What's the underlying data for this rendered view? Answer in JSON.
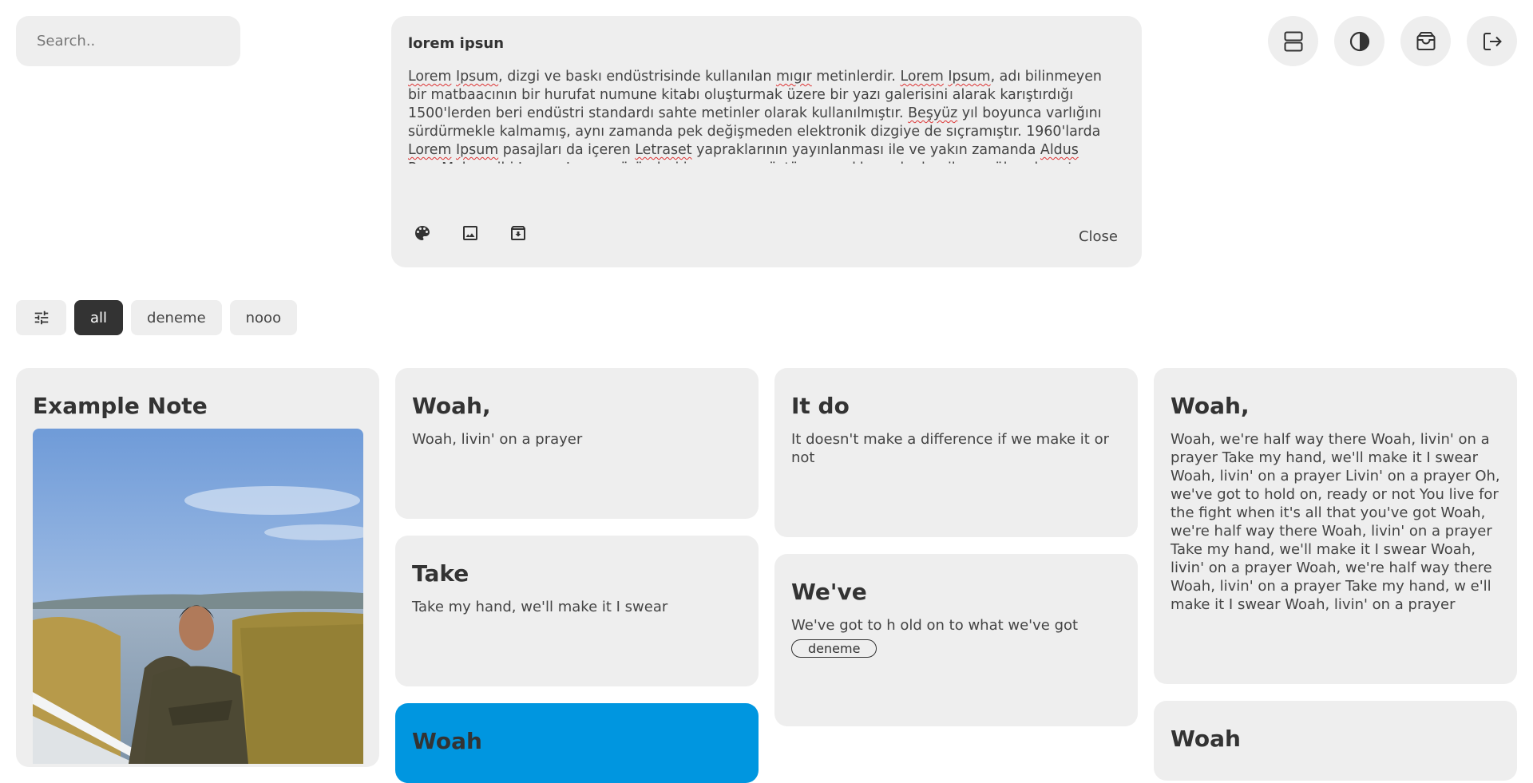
{
  "search": {
    "placeholder": "Search.."
  },
  "composer": {
    "title": "lorem ipsun",
    "body": [
      {
        "t": "Lorem",
        "sp": true
      },
      {
        "t": " "
      },
      {
        "t": "Ipsum",
        "sp": true
      },
      {
        "t": ", dizgi ve baskı endüstrisinde kullanılan "
      },
      {
        "t": "mıgır",
        "sp": true
      },
      {
        "t": " metinlerdir. "
      },
      {
        "t": "Lorem",
        "sp": true
      },
      {
        "t": " "
      },
      {
        "t": "Ipsum",
        "sp": true
      },
      {
        "t": ", adı bilinmeyen bir matbaacının bir hurufat numune kitabı oluşturmak üzere bir yazı galerisini alarak karıştırdığı 1500'lerden beri endüstri standardı sahte metinler olarak kullanılmıştır. "
      },
      {
        "t": "Beşyüz",
        "sp": true
      },
      {
        "t": " yıl boyunca varlığını sürdürmekle kalmamış, aynı zamanda pek değişmeden elektronik dizgiye de sıçramıştır. 1960'larda "
      },
      {
        "t": "Lorem",
        "sp": true
      },
      {
        "t": " "
      },
      {
        "t": "Ipsum",
        "sp": true
      },
      {
        "t": " pasajları da içeren "
      },
      {
        "t": "Letraset",
        "sp": true
      },
      {
        "t": " yapraklarının yayınlanması ile ve yakın zamanda "
      },
      {
        "t": "Aldus",
        "sp": true
      },
      {
        "t": " "
      },
      {
        "t": "PageMaker",
        "sp": true
      },
      {
        "t": " gibi "
      },
      {
        "t": "Lorem",
        "sp": true
      },
      {
        "t": " "
      },
      {
        "t": "Ipsum",
        "sp": true
      },
      {
        "t": " sürümleri içeren masaüstü yayıncılık yazılımları ile popüler olmuştur."
      }
    ],
    "tools": [
      "palette-icon",
      "image-icon",
      "archive-icon"
    ],
    "close_label": "Close"
  },
  "top_actions": [
    "layout-icon",
    "contrast-icon",
    "archive-box-icon",
    "logout-icon"
  ],
  "filters": {
    "icon": "tune-icon",
    "chips": [
      {
        "label": "all",
        "active": true
      },
      {
        "label": "deneme",
        "active": false
      },
      {
        "label": "nooo",
        "active": false
      }
    ]
  },
  "colors": {
    "card_bg": "#eeeeee",
    "active_chip": "#333333",
    "accent_card": "#0096e0"
  },
  "notes": [
    {
      "title": "Example Note",
      "text": "",
      "has_image": true
    },
    {
      "title": "Woah,",
      "text": "Woah, livin' on a prayer"
    },
    {
      "title": "Take",
      "text": "Take my hand, we'll make it I swear"
    },
    {
      "title": "Woah",
      "text": ""
    },
    {
      "title": "It do",
      "text": "It doesn't make a difference if we make it or not"
    },
    {
      "title": "We've",
      "text": "We've got to h old on to what we've got",
      "tag": "deneme"
    },
    {
      "title": "Woah,",
      "text": "Woah, we're half way there Woah, livin' on a prayer Take my hand, we'll make it I swear Woah, livin' on a prayer Livin' on a prayer Oh, we've got to hold on, ready or not You live for the fight when it's all that you've got Woah, we're half way there Woah, livin' on a prayer Take my hand, we'll make it I swear Woah, livin' on a prayer Woah, we're half way there Woah, livin' on a prayer Take my hand, w e'll make it I swear Woah, livin' on a prayer"
    },
    {
      "title": "Woah",
      "text": ""
    }
  ]
}
